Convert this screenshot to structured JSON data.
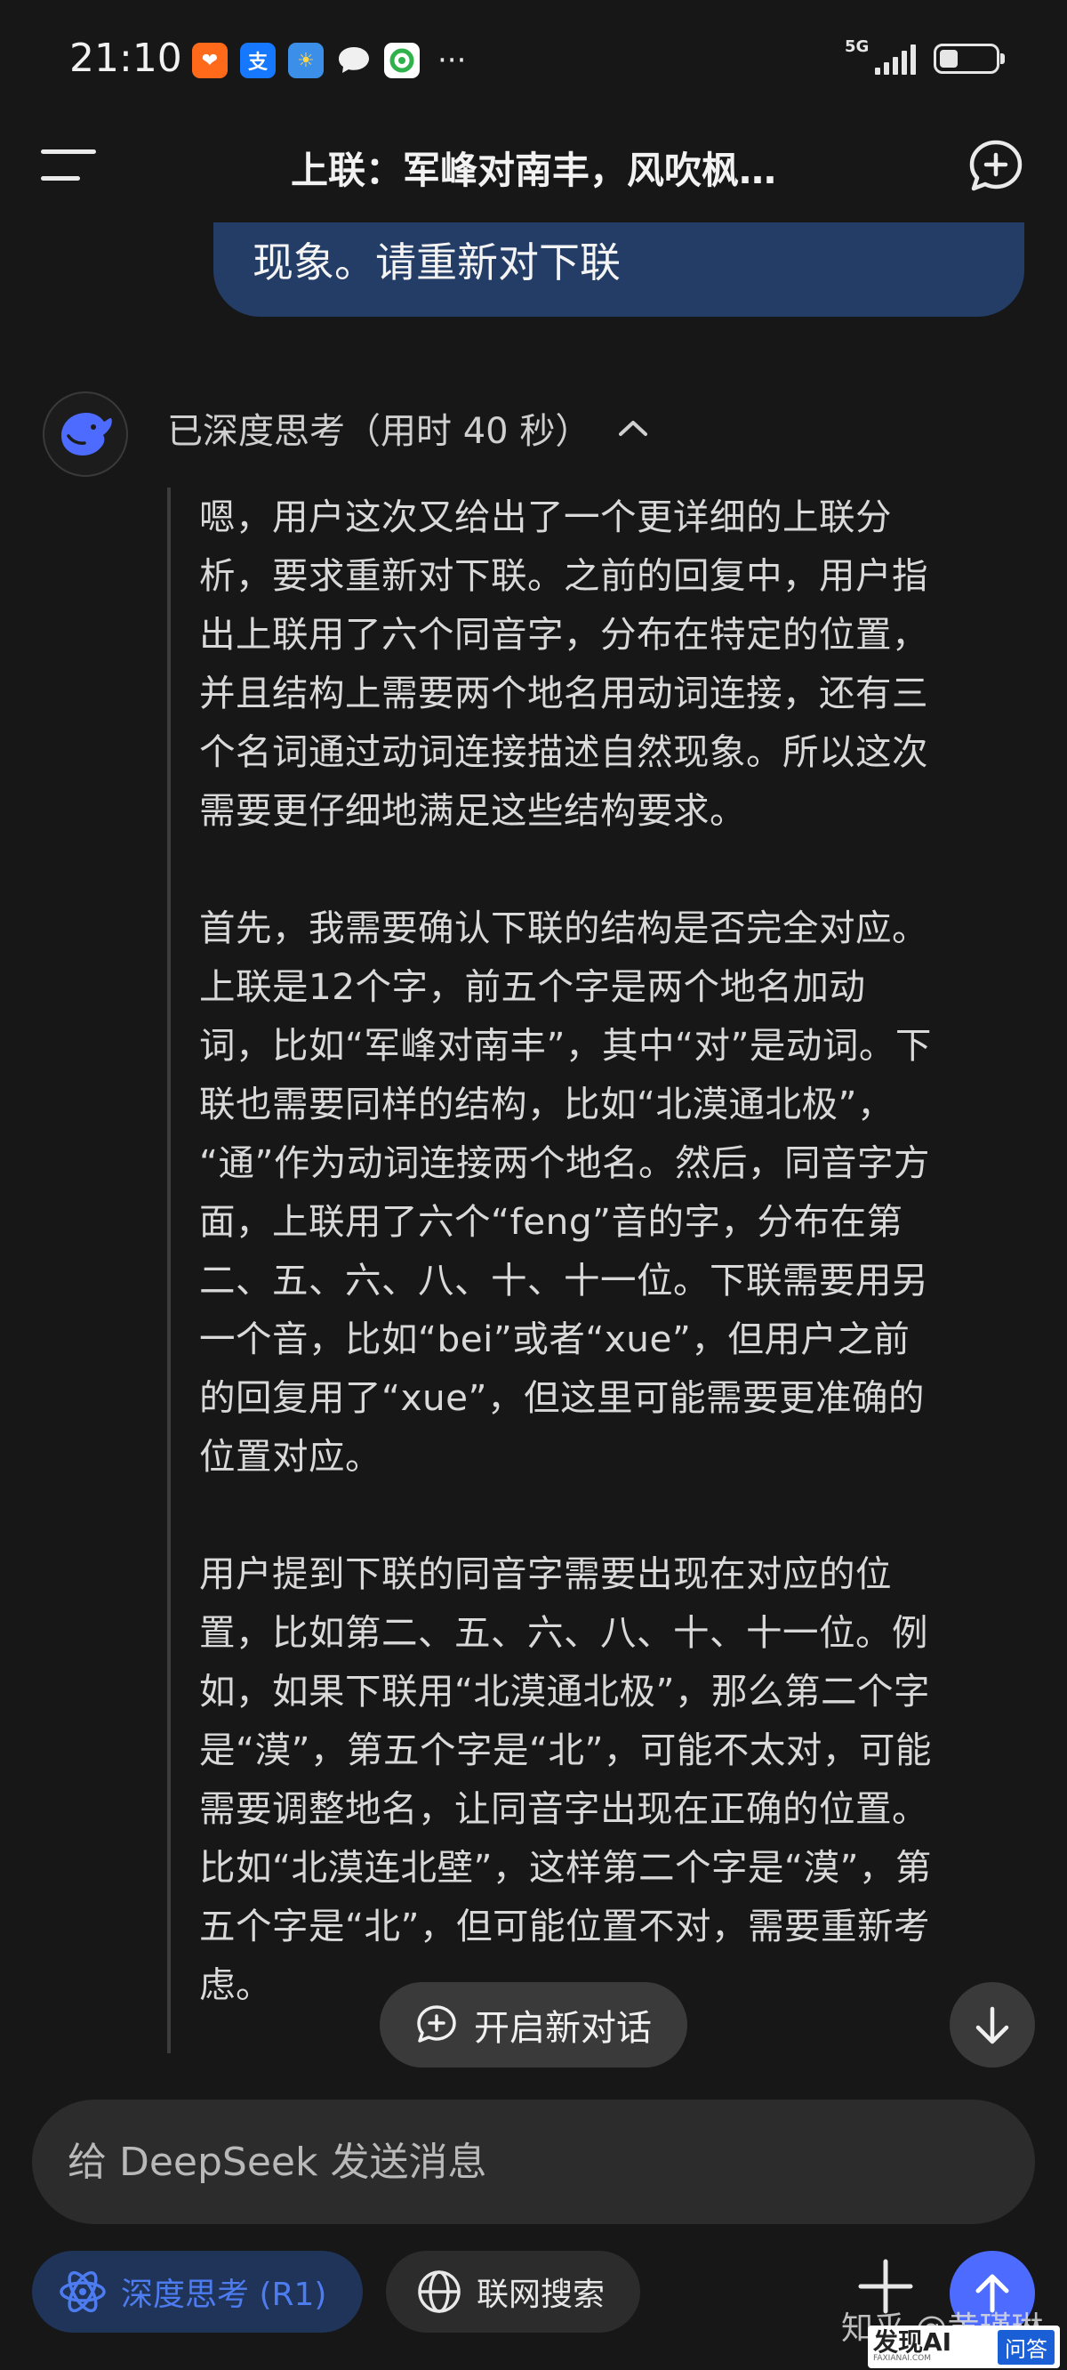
{
  "status_bar": {
    "time": "21:10",
    "apps": [
      {
        "icon": "taobao-icon",
        "glyph": "❤",
        "color": "#ff6a1a"
      },
      {
        "icon": "alipay-icon",
        "glyph": "支",
        "color": "#1677ff"
      },
      {
        "icon": "weather-icon",
        "glyph": "☀",
        "color": "#3b8fe8"
      },
      {
        "icon": "message-icon",
        "glyph": "●",
        "color": "#f0f0f0"
      },
      {
        "icon": "wechat-mini-icon",
        "glyph": "✿",
        "color": "#2fb24c"
      }
    ],
    "more": "···",
    "network": "5G"
  },
  "header": {
    "title": "上联：军峰对南丰，风吹枫…"
  },
  "user_message": {
    "text": "现象。请重新对下联"
  },
  "thinking": {
    "label": "已深度思考（用时 40 秒）",
    "paragraphs": [
      "嗯，用户这次又给出了一个更详细的上联分\n析，要求重新对下联。之前的回复中，用户指\n出上联用了六个同音字，分布在特定的位置，\n并且结构上需要两个地名用动词连接，还有三\n个名词通过动词连接描述自然现象。所以这次\n需要更仔细地满足这些结构要求。",
      "首先，我需要确认下联的结构是否完全对应。\n上联是12个字，前五个字是两个地名加动\n词，比如“军峰对南丰”，其中“对”是动词。下\n联也需要同样的结构，比如“北漠通北极”，\n“通”作为动词连接两个地名。然后，同音字方\n面，上联用了六个“feng”音的字，分布在第\n二、五、六、八、十、十一位。下联需要用另\n一个音，比如“bei”或者“xue”，但用户之前\n的回复用了“xue”，但这里可能需要更准确的\n位置对应。",
      "用户提到下联的同音字需要出现在对应的位\n置，比如第二、五、六、八、十、十一位。例\n如，如果下联用“北漠通北极”，那么第二个字\n是“漠”，第五个字是“北”，可能不太对，可能\n需要调整地名，让同音字出现在正确的位置。\n比如“北漠连北壁”，这样第二个字是“漠”，第\n五个字是“北”，但可能位置不对，需要重新考\n虑。"
    ]
  },
  "new_conversation": {
    "label": "开启新对话"
  },
  "composer": {
    "placeholder": "给 DeepSeek 发送消息"
  },
  "toolbar": {
    "deep_think_label": "深度思考 (R1)",
    "web_search_label": "联网搜索"
  },
  "watermark": {
    "zhihu": "知乎 @黄瑾琳",
    "badge_text": "发现AI",
    "badge_sub": "FAXIANAI.COM",
    "badge_qa": "问答"
  },
  "colors": {
    "background": "#171717",
    "user_bubble": "#243d66",
    "accent": "#4d6bfe",
    "deep_think_text": "#4d7cf0"
  }
}
